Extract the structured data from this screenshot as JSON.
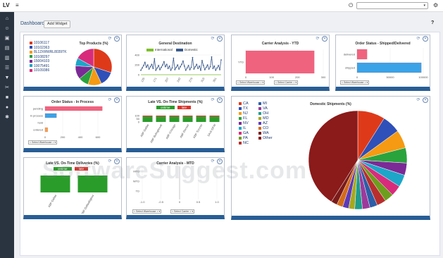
{
  "topbar": {
    "logo": "LV",
    "menu_icon": "≡",
    "power_icon": "⏻",
    "select_caret": "▾",
    "settings_icon": "⚙"
  },
  "dashboard": {
    "title": "Dashboard",
    "add_widget_label": "Add Widget",
    "help_label": "?"
  },
  "watermark": "SoftwareSuggest.com",
  "widget_controls": {
    "refresh": "⟳",
    "close": "✕"
  },
  "top_products": {
    "title": "Top Products (%)",
    "legend": [
      "10106117",
      "10102363",
      "8L12XRWRL8039TK",
      "10108297",
      "15004103",
      "10075491",
      "10109386"
    ],
    "colors": [
      "#de3a1a",
      "#2e50b8",
      "#f59a12",
      "#2aa33d",
      "#7b2a96",
      "#1da6c8",
      "#d92b7c"
    ],
    "chart_data": {
      "type": "pie",
      "values": [
        30,
        13,
        12,
        9,
        12,
        7,
        17
      ]
    }
  },
  "general_dest": {
    "title": "General Destination",
    "legend": [
      "International",
      "Domestic"
    ],
    "legend_colors": [
      "#7cbf2a",
      "#3a5a8c"
    ],
    "y_ticks": [
      "400",
      "200",
      "0"
    ],
    "x_ticks": [
      "135",
      "171",
      "207",
      "243",
      "279",
      "315",
      "351"
    ],
    "chart_data": {
      "type": "line",
      "ylim": [
        0,
        400
      ],
      "note_series": "Domestic"
    }
  },
  "carrier_ytd": {
    "title": "Carrier Analysis - YTD",
    "selects": [
      "< Select Warehouse > ▾",
      "< Select Carrier > ▾"
    ],
    "chart_data": {
      "type": "bar",
      "categories": [
        "YTD"
      ],
      "values": [
        265
      ],
      "xlim": [
        0,
        300
      ],
      "x_ticks": [
        "0",
        "100",
        "200",
        "300"
      ],
      "color": "#f0637f"
    }
  },
  "order_status_shipped": {
    "title": "Order Status - Shipped/Delivered",
    "select": "< Select Warehouse > ▾",
    "chart_data": {
      "type": "bar",
      "categories": [
        "delivered",
        "shipped"
      ],
      "values": [
        15000,
        97000
      ],
      "xlim": [
        0,
        100000
      ],
      "x_ticks": [
        "0",
        "50000",
        "100000"
      ],
      "colors": [
        "#f0637f",
        "#3aa3e8"
      ]
    }
  },
  "order_status_process": {
    "title": "Order Status - In Process",
    "select": "< Select Warehouse > ▾",
    "chart_data": {
      "type": "bar",
      "categories": [
        "pending",
        "in process",
        "hold",
        "entered"
      ],
      "values": [
        650,
        130,
        0,
        30
      ],
      "xlim": [
        0,
        800
      ],
      "x_ticks": [
        "0",
        "200",
        "400",
        "600"
      ],
      "colors": [
        "#f0637f",
        "#3aa3e8",
        "#f5c342",
        "#f5a04a"
      ]
    }
  },
  "late_shipments": {
    "title": "Late VS. On-Time Shipments (%)",
    "legend": [
      "ontime",
      "late"
    ],
    "legend_colors": [
      "#2a9c2a",
      "#d9342b"
    ],
    "y_ticks": [
      "100",
      "50",
      "0"
    ],
    "categories": [
      "ABF-Dallas",
      "ABF-Bolingbrook",
      "ABF-Chicago",
      "ABF-Denver",
      "ABF-Toronto",
      "SAIA-DFW"
    ],
    "chart_data": {
      "type": "bar",
      "stacked": true,
      "ontime": [
        85,
        85,
        85,
        85,
        85,
        85
      ],
      "late": [
        15,
        15,
        15,
        15,
        15,
        15
      ]
    }
  },
  "domestic_shipments": {
    "title": "Domestic Shipments (%)",
    "legend_left": [
      "CA",
      "TX",
      "NJ",
      "FL",
      "NV",
      "IL",
      "GA",
      "PA",
      "NC"
    ],
    "legend_right": [
      "MI",
      "VA",
      "OH",
      "MD",
      "AZ",
      "CO",
      "WA",
      "Other"
    ],
    "colors_left": [
      "#de3a1a",
      "#2e50b8",
      "#f59a12",
      "#2aa33d",
      "#7b2a96",
      "#1da6c8",
      "#d92b7c",
      "#6e9e1e",
      "#b82e2e"
    ],
    "colors_right": [
      "#2d5ea8",
      "#9c3a9c",
      "#1f9c8c",
      "#a8a81e",
      "#5c3ab8",
      "#d36b1a",
      "#7a1b1b",
      "#8b1a1a"
    ],
    "chart_data": {
      "type": "pie",
      "categories": [
        "CA",
        "TX",
        "NJ",
        "FL",
        "NV",
        "IL",
        "GA",
        "PA",
        "NC",
        "MI",
        "VA",
        "OH",
        "MD",
        "AZ",
        "CO",
        "WA",
        "Other"
      ],
      "values": [
        9,
        6,
        6,
        5,
        4,
        4,
        3.5,
        3,
        3,
        2.5,
        2.5,
        2.5,
        2,
        2,
        2,
        2,
        41
      ]
    }
  },
  "late_deliveries": {
    "title": "Late VS. On-Time Deliveries (%)",
    "legend": [
      "ontime",
      "late"
    ],
    "legend_colors": [
      "#2a9c2a",
      "#d9342b"
    ],
    "categories": [
      "ABF-Dallas",
      "ABF-DallasBigbox"
    ],
    "chart_data": {
      "type": "bar",
      "stacked": true,
      "ontime": [
        100,
        100
      ],
      "late": [
        0,
        0
      ]
    }
  },
  "carrier_mtd": {
    "title": "Carrier Analysis - MTD",
    "selects": [
      "< Select Warehouse > ▾",
      "< Select Carrier > ▾"
    ],
    "chart_data": {
      "type": "bar",
      "categories": [
        "MTD",
        "WTD",
        "TD"
      ],
      "values": [
        0,
        0,
        0
      ],
      "xlim": [
        -1,
        1
      ],
      "x_ticks": [
        "-1.0",
        "-0.5",
        "0",
        "0.5",
        "1.0"
      ]
    }
  }
}
